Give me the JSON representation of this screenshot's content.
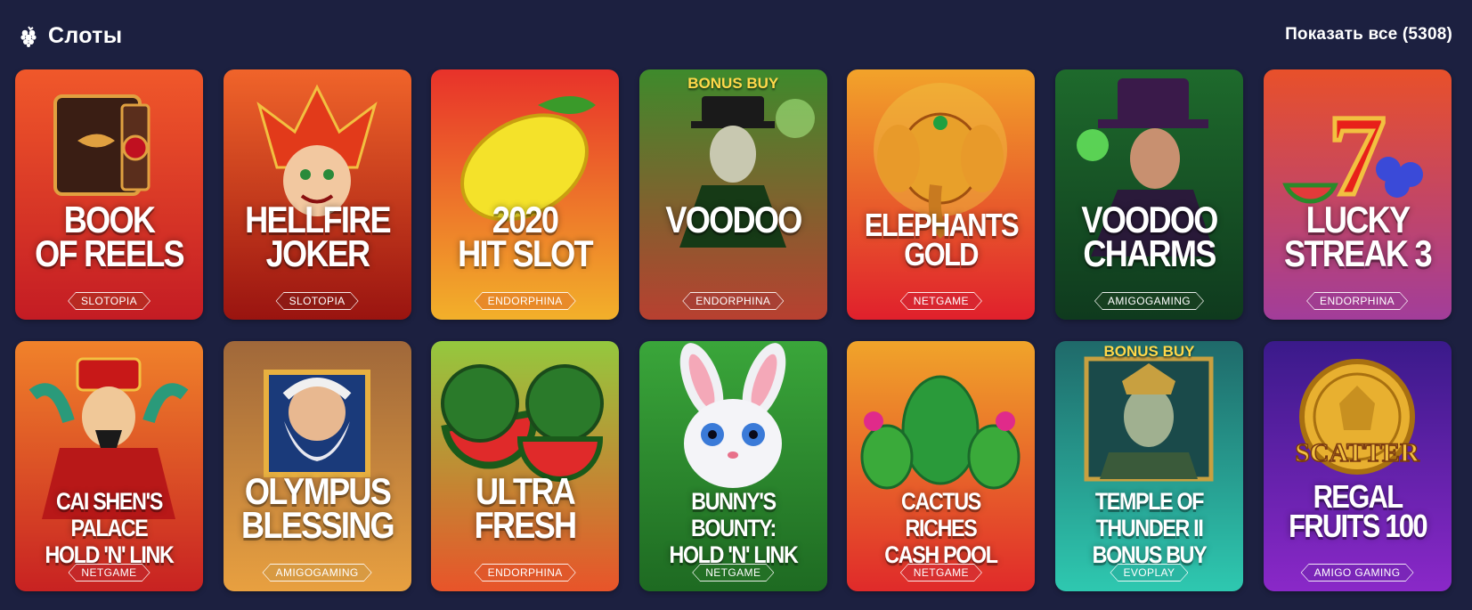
{
  "header": {
    "title": "Слоты",
    "show_all": "Показать все (5308)"
  },
  "games": [
    {
      "title": "BOOK\nOF REELS",
      "provider": "SLOTOPIA",
      "top_tag": "",
      "bg": [
        "#f0582a",
        "#c41c24"
      ],
      "prov_bg": "#b82a22",
      "icon": "book-icon"
    },
    {
      "title": "HELLFIRE\nJOKER",
      "provider": "SLOTOPIA",
      "top_tag": "",
      "bg": [
        "#f0642a",
        "#9a1410"
      ],
      "prov_bg": "#8e1a14",
      "icon": "jester-icon"
    },
    {
      "title": "2020\nHIT SLOT",
      "provider": "ENDORPHINA",
      "top_tag": "",
      "bg": [
        "#e8322a",
        "#f2b02a"
      ],
      "prov_bg": "#e88a28",
      "icon": "lemon-icon"
    },
    {
      "title": "VOODOO",
      "provider": "ENDORPHINA",
      "top_tag": "BONUS BUY",
      "bg": [
        "#3e8a2c",
        "#b84030"
      ],
      "prov_bg": "#a84034",
      "icon": "voodoo-man-icon"
    },
    {
      "title": "ELEPHANTS\nGOLD",
      "provider": "NETGAME",
      "top_tag": "",
      "bg": [
        "#f2a32a",
        "#e0202c"
      ],
      "prov_bg": "#d82630",
      "icon": "elephant-icon"
    },
    {
      "title": "VOODOO\nCHARMS",
      "provider": "AMIGOGAMING",
      "top_tag": "",
      "bg": [
        "#1e6a2c",
        "#0f3a1e"
      ],
      "prov_bg": "#173f20",
      "icon": "witch-doctor-icon"
    },
    {
      "title": "LUCKY\nSTREAK 3",
      "provider": "ENDORPHINA",
      "top_tag": "",
      "bg": [
        "#e8502a",
        "#a23d9a"
      ],
      "prov_bg": "#a03c90",
      "icon": "seven-fruit-icon"
    },
    {
      "title": "CAI SHEN'S PALACE\nHOLD 'N' LINK",
      "provider": "NETGAME",
      "top_tag": "",
      "bg": [
        "#f0822a",
        "#c82222"
      ],
      "prov_bg": "#c42828",
      "icon": "cai-shen-icon"
    },
    {
      "title": "OLYMPUS\nBLESSING",
      "provider": "AMIGOGAMING",
      "top_tag": "",
      "bg": [
        "#a0683a",
        "#e8a040"
      ],
      "prov_bg": "#d89a42",
      "icon": "zeus-icon"
    },
    {
      "title": "ULTRA\nFRESH",
      "provider": "ENDORPHINA",
      "top_tag": "",
      "bg": [
        "#94c83e",
        "#e8542a"
      ],
      "prov_bg": "#e0582a",
      "icon": "watermelon-icon"
    },
    {
      "title": "BUNNY'S BOUNTY:\nHOLD 'N' LINK",
      "provider": "NETGAME",
      "top_tag": "",
      "bg": [
        "#3aa63a",
        "#1e6a22"
      ],
      "prov_bg": "#237025",
      "icon": "bunny-icon"
    },
    {
      "title": "CACTUS RICHES\nCASH POOL",
      "provider": "NETGAME",
      "top_tag": "",
      "bg": [
        "#f0a42a",
        "#e02a2a"
      ],
      "prov_bg": "#d83030",
      "icon": "cactus-icon"
    },
    {
      "title": "TEMPLE OF\nTHUNDER II\nBONUS BUY",
      "provider": "EVOPLAY",
      "top_tag": "BONUS BUY",
      "bg": [
        "#1f6a6a",
        "#2ec8b0"
      ],
      "prov_bg": "#2ab6a2",
      "icon": "warrior-icon"
    },
    {
      "title": "REGAL\nFRUITS 100",
      "provider": "AMIGO GAMING",
      "top_tag": "",
      "bg": [
        "#3a1a8a",
        "#8a28c8"
      ],
      "prov_bg": "#7a26b8",
      "icon": "scatter-coin-icon"
    }
  ],
  "scatter_label": "SCATTER"
}
